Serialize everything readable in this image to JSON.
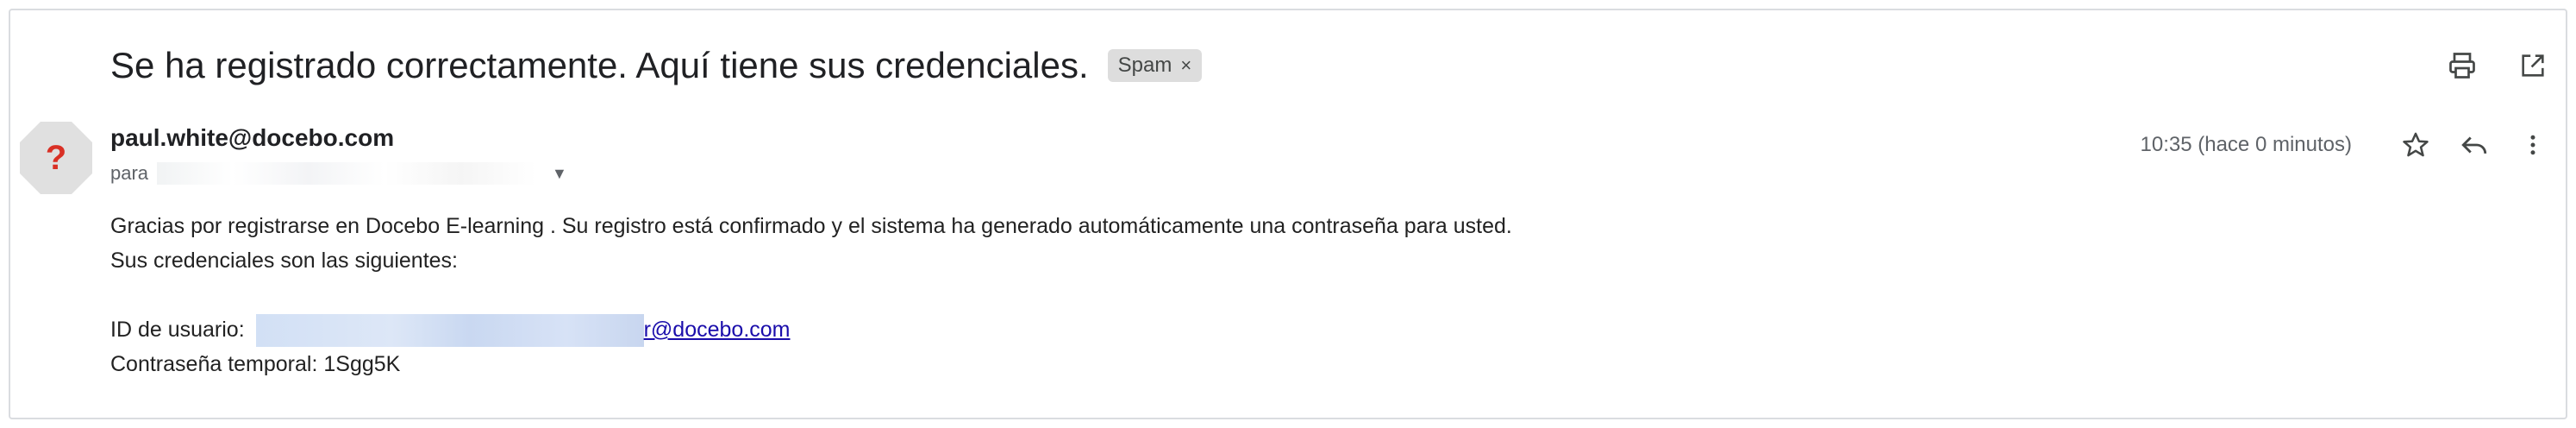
{
  "email": {
    "subject": "Se ha registrado correctamente. Aquí tiene sus credenciales.",
    "label_chip": "Spam",
    "label_chip_close": "×",
    "sender": "paul.white@docebo.com",
    "to_prefix": "para",
    "timestamp": "10:35 (hace 0 minutos)",
    "avatar_glyph": "?",
    "body": {
      "line1": "Gracias por registrarse en Docebo E-learning . Su registro está confirmado y el sistema ha generado automáticamente una contraseña para usted.",
      "line2": "Sus credenciales son las siguientes:",
      "user_id_label": "ID de usuario:",
      "user_id_visible": "r@docebo.com",
      "password_label": "Contraseña temporal:",
      "password_visible": "1Sgg5K"
    }
  },
  "icons": {
    "print": "print-icon",
    "open_new_window": "open-in-new-icon",
    "star": "star-icon",
    "reply": "reply-icon",
    "more": "more-vert-icon",
    "avatar": "unknown-sender-icon",
    "expand_recipients": "chevron-down-icon"
  },
  "colors": {
    "avatar_bg": "#e0e0e0",
    "avatar_glyph": "#d93025",
    "link": "#1a0dab",
    "spam_chip": "#dddddd"
  }
}
